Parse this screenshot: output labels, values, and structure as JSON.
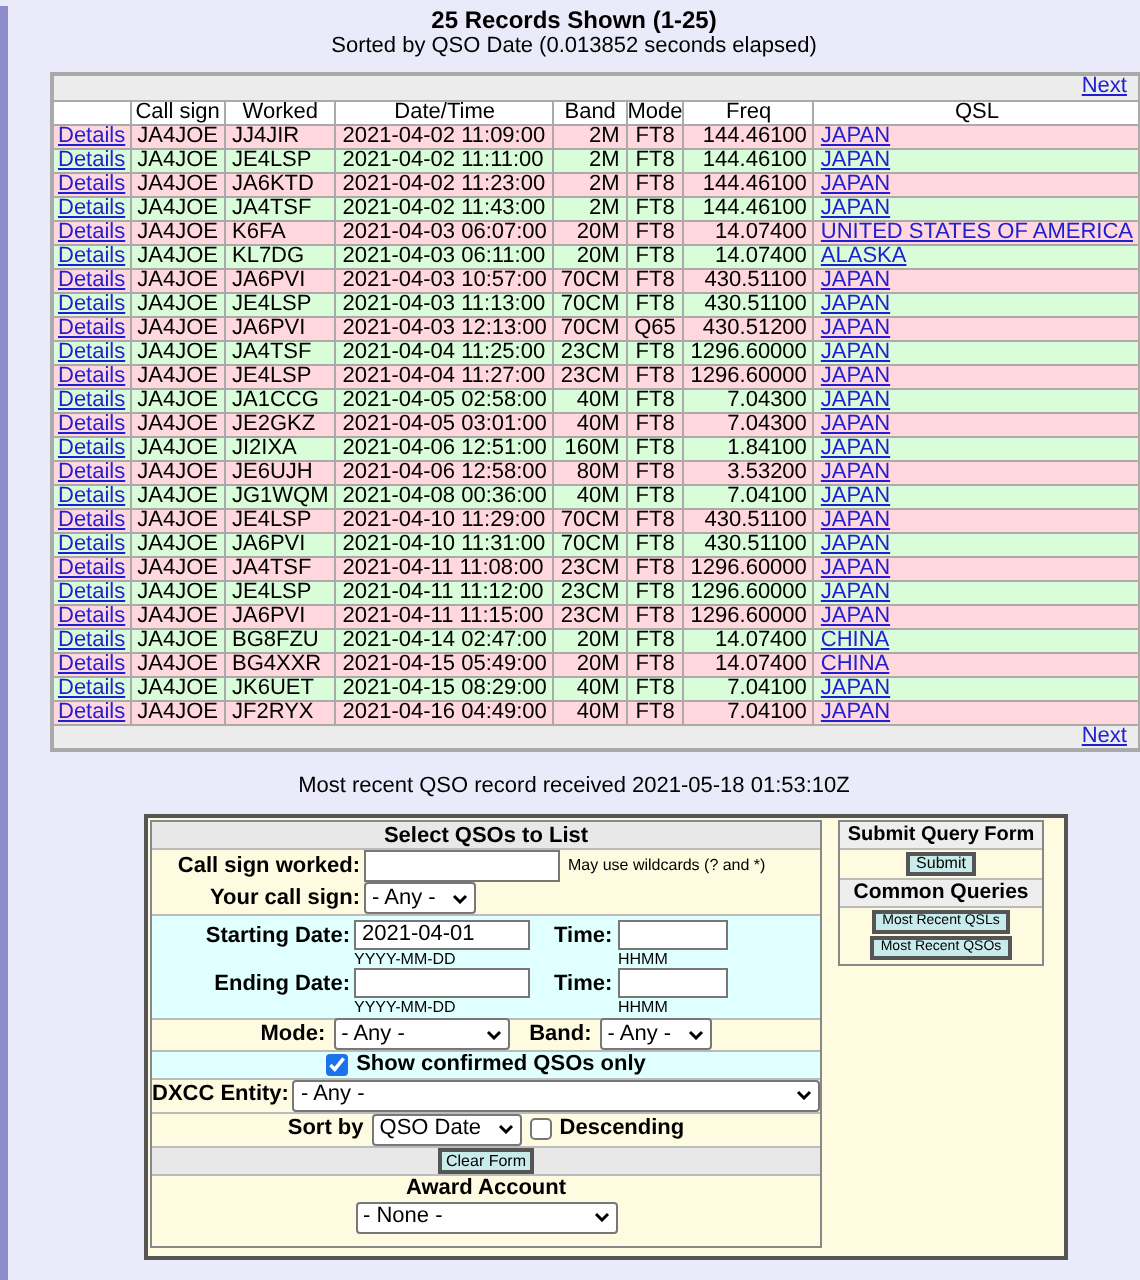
{
  "header": {
    "title": "25 Records Shown (1-25)",
    "subtitle": "Sorted by QSO Date (0.013852 seconds elapsed)"
  },
  "pager": {
    "top": "Next",
    "bottom": "Next"
  },
  "table": {
    "columns": [
      "Call sign",
      "Worked",
      "Date/Time",
      "Band",
      "Mode",
      "Freq",
      "QSL"
    ],
    "rows": [
      {
        "link": "Details",
        "call_sign": "JA4JOE",
        "worked": "JJ4JIR",
        "datetime": "2021-04-02 11:09:00",
        "band": "2M",
        "mode": "FT8",
        "freq": "144.46100",
        "qsl": "JAPAN"
      },
      {
        "link": "Details",
        "call_sign": "JA4JOE",
        "worked": "JE4LSP",
        "datetime": "2021-04-02 11:11:00",
        "band": "2M",
        "mode": "FT8",
        "freq": "144.46100",
        "qsl": "JAPAN"
      },
      {
        "link": "Details",
        "call_sign": "JA4JOE",
        "worked": "JA6KTD",
        "datetime": "2021-04-02 11:23:00",
        "band": "2M",
        "mode": "FT8",
        "freq": "144.46100",
        "qsl": "JAPAN"
      },
      {
        "link": "Details",
        "call_sign": "JA4JOE",
        "worked": "JA4TSF",
        "datetime": "2021-04-02 11:43:00",
        "band": "2M",
        "mode": "FT8",
        "freq": "144.46100",
        "qsl": "JAPAN"
      },
      {
        "link": "Details",
        "call_sign": "JA4JOE",
        "worked": "K6FA",
        "datetime": "2021-04-03 06:07:00",
        "band": "20M",
        "mode": "FT8",
        "freq": "14.07400",
        "qsl": "UNITED STATES OF AMERICA"
      },
      {
        "link": "Details",
        "call_sign": "JA4JOE",
        "worked": "KL7DG",
        "datetime": "2021-04-03 06:11:00",
        "band": "20M",
        "mode": "FT8",
        "freq": "14.07400",
        "qsl": "ALASKA"
      },
      {
        "link": "Details",
        "call_sign": "JA4JOE",
        "worked": "JA6PVI",
        "datetime": "2021-04-03 10:57:00",
        "band": "70CM",
        "mode": "FT8",
        "freq": "430.51100",
        "qsl": "JAPAN"
      },
      {
        "link": "Details",
        "call_sign": "JA4JOE",
        "worked": "JE4LSP",
        "datetime": "2021-04-03 11:13:00",
        "band": "70CM",
        "mode": "FT8",
        "freq": "430.51100",
        "qsl": "JAPAN"
      },
      {
        "link": "Details",
        "call_sign": "JA4JOE",
        "worked": "JA6PVI",
        "datetime": "2021-04-03 12:13:00",
        "band": "70CM",
        "mode": "Q65",
        "freq": "430.51200",
        "qsl": "JAPAN"
      },
      {
        "link": "Details",
        "call_sign": "JA4JOE",
        "worked": "JA4TSF",
        "datetime": "2021-04-04 11:25:00",
        "band": "23CM",
        "mode": "FT8",
        "freq": "1296.60000",
        "qsl": "JAPAN"
      },
      {
        "link": "Details",
        "call_sign": "JA4JOE",
        "worked": "JE4LSP",
        "datetime": "2021-04-04 11:27:00",
        "band": "23CM",
        "mode": "FT8",
        "freq": "1296.60000",
        "qsl": "JAPAN"
      },
      {
        "link": "Details",
        "call_sign": "JA4JOE",
        "worked": "JA1CCG",
        "datetime": "2021-04-05 02:58:00",
        "band": "40M",
        "mode": "FT8",
        "freq": "7.04300",
        "qsl": "JAPAN"
      },
      {
        "link": "Details",
        "call_sign": "JA4JOE",
        "worked": "JE2GKZ",
        "datetime": "2021-04-05 03:01:00",
        "band": "40M",
        "mode": "FT8",
        "freq": "7.04300",
        "qsl": "JAPAN"
      },
      {
        "link": "Details",
        "call_sign": "JA4JOE",
        "worked": "JI2IXA",
        "datetime": "2021-04-06 12:51:00",
        "band": "160M",
        "mode": "FT8",
        "freq": "1.84100",
        "qsl": "JAPAN"
      },
      {
        "link": "Details",
        "call_sign": "JA4JOE",
        "worked": "JE6UJH",
        "datetime": "2021-04-06 12:58:00",
        "band": "80M",
        "mode": "FT8",
        "freq": "3.53200",
        "qsl": "JAPAN"
      },
      {
        "link": "Details",
        "call_sign": "JA4JOE",
        "worked": "JG1WQM",
        "datetime": "2021-04-08 00:36:00",
        "band": "40M",
        "mode": "FT8",
        "freq": "7.04100",
        "qsl": "JAPAN"
      },
      {
        "link": "Details",
        "call_sign": "JA4JOE",
        "worked": "JE4LSP",
        "datetime": "2021-04-10 11:29:00",
        "band": "70CM",
        "mode": "FT8",
        "freq": "430.51100",
        "qsl": "JAPAN"
      },
      {
        "link": "Details",
        "call_sign": "JA4JOE",
        "worked": "JA6PVI",
        "datetime": "2021-04-10 11:31:00",
        "band": "70CM",
        "mode": "FT8",
        "freq": "430.51100",
        "qsl": "JAPAN"
      },
      {
        "link": "Details",
        "call_sign": "JA4JOE",
        "worked": "JA4TSF",
        "datetime": "2021-04-11 11:08:00",
        "band": "23CM",
        "mode": "FT8",
        "freq": "1296.60000",
        "qsl": "JAPAN"
      },
      {
        "link": "Details",
        "call_sign": "JA4JOE",
        "worked": "JE4LSP",
        "datetime": "2021-04-11 11:12:00",
        "band": "23CM",
        "mode": "FT8",
        "freq": "1296.60000",
        "qsl": "JAPAN"
      },
      {
        "link": "Details",
        "call_sign": "JA4JOE",
        "worked": "JA6PVI",
        "datetime": "2021-04-11 11:15:00",
        "band": "23CM",
        "mode": "FT8",
        "freq": "1296.60000",
        "qsl": "JAPAN"
      },
      {
        "link": "Details",
        "call_sign": "JA4JOE",
        "worked": "BG8FZU",
        "datetime": "2021-04-14 02:47:00",
        "band": "20M",
        "mode": "FT8",
        "freq": "14.07400",
        "qsl": "CHINA"
      },
      {
        "link": "Details",
        "call_sign": "JA4JOE",
        "worked": "BG4XXR",
        "datetime": "2021-04-15 05:49:00",
        "band": "20M",
        "mode": "FT8",
        "freq": "14.07400",
        "qsl": "CHINA"
      },
      {
        "link": "Details",
        "call_sign": "JA4JOE",
        "worked": "JK6UET",
        "datetime": "2021-04-15 08:29:00",
        "band": "40M",
        "mode": "FT8",
        "freq": "7.04100",
        "qsl": "JAPAN"
      },
      {
        "link": "Details",
        "call_sign": "JA4JOE",
        "worked": "JF2RYX",
        "datetime": "2021-04-16 04:49:00",
        "band": "40M",
        "mode": "FT8",
        "freq": "7.04100",
        "qsl": "JAPAN"
      }
    ]
  },
  "last_received": "Most recent QSO record received 2021-05-18 01:53:10Z",
  "form": {
    "title": "Select QSOs to List",
    "call_worked": {
      "label": "Call sign worked:",
      "hint": "May use wildcards (? and *)"
    },
    "your_call": {
      "label": "Your call sign:",
      "value": "- Any -"
    },
    "start_date": {
      "label": "Starting Date:",
      "value": "2021-04-01",
      "format": "YYYY-MM-DD",
      "time_label": "Time:",
      "time_format": "HHMM"
    },
    "end_date": {
      "label": "Ending Date:",
      "format": "YYYY-MM-DD",
      "time_label": "Time:",
      "time_format": "HHMM"
    },
    "mode": {
      "label": "Mode:",
      "value": "- Any -"
    },
    "band": {
      "label": "Band:",
      "value": "- Any -"
    },
    "confirmed": {
      "label": "Show confirmed QSOs only",
      "checked": true
    },
    "dxcc": {
      "label": "DXCC Entity:",
      "value": "- Any -"
    },
    "sort": {
      "label": "Sort by",
      "value": "QSO Date"
    },
    "descending": {
      "label": "Descending",
      "checked": false
    },
    "clear": "Clear Form",
    "award": {
      "label": "Award Account",
      "value": "- None -"
    }
  },
  "side": {
    "title": "Submit Query Form",
    "submit": "Submit",
    "common_title": "Common Queries",
    "buttons": [
      "Most Recent QSLs",
      "Most Recent QSOs"
    ]
  }
}
